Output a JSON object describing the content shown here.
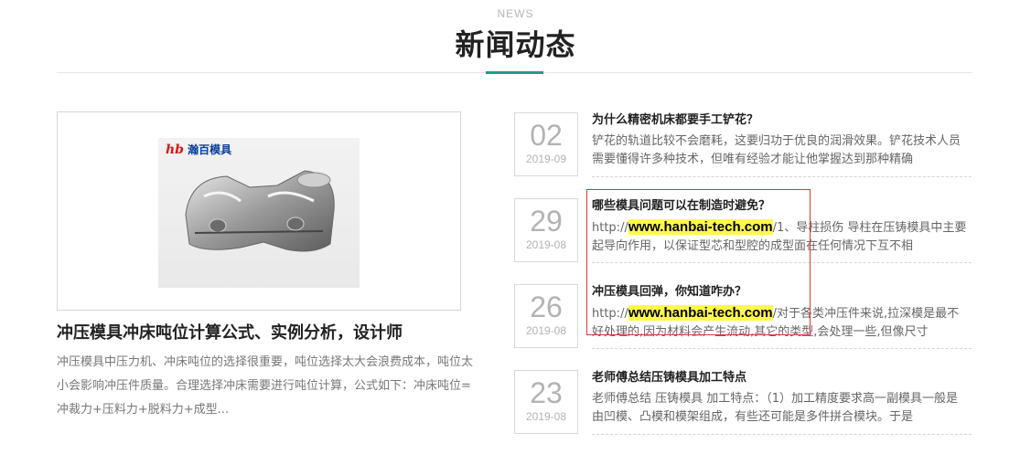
{
  "header": {
    "en": "NEWS",
    "cn": "新闻动态"
  },
  "feature": {
    "logo_text": "瀚百模具",
    "title": "冲压模具冲床吨位计算公式、实例分析，设计师",
    "desc": "冲压模具中压力机、冲床吨位的选择很重要，吨位选择太大会浪费成本，吨位太小会影响冲压件质量。合理选择冲床需要进行吨位计算，公式如下：冲床吨位=冲裁力+压料力+脱料力+成型..."
  },
  "news": [
    {
      "day": "02",
      "ym": "2019-09",
      "title": "为什么精密机床都要手工铲花？",
      "desc_pre": "",
      "url": "",
      "desc": "铲花的轨道比较不会磨耗，这要归功于优良的润滑效果。铲花技术人员需要懂得许多种技术，但唯有经验才能让他掌握达到那种精确"
    },
    {
      "day": "29",
      "ym": "2019-08",
      "title": "哪些模具问题可以在制造时避免？",
      "desc_pre": "http://",
      "url": "www.hanbai-tech.com",
      "desc": "/1、导柱损伤 导柱在压铸模具中主要起导向作用，以保证型芯和型腔的成型面在任何情况下互不相"
    },
    {
      "day": "26",
      "ym": "2019-08",
      "title": "冲压模具回弹，你知道咋办？",
      "desc_pre": "http://",
      "url": "www.hanbai-tech.com",
      "desc": "/对于各类冲压件来说,拉深模是最不好处理的,因为材料会产生流动,其它的类型,会处理一些,但像尺寸"
    },
    {
      "day": "23",
      "ym": "2019-08",
      "title": "老师傅总结压铸模具加工特点",
      "desc_pre": "",
      "url": "",
      "desc": "老师傅总结 压铸模具 加工特点：（1）加工精度要求高一副模具一般是由凹模、凸模和模架组成，有些还可能是多件拼合模块。于是"
    }
  ]
}
